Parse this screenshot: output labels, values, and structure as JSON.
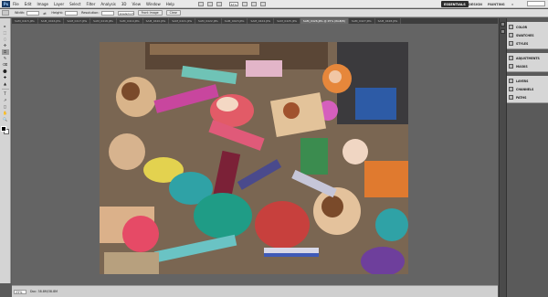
{
  "app": {
    "logo": "Ps"
  },
  "menu": [
    "File",
    "Edit",
    "Image",
    "Layer",
    "Select",
    "Filter",
    "Analysis",
    "3D",
    "View",
    "Window",
    "Help"
  ],
  "menubar": {
    "zoom": "67%",
    "workspaces": [
      "ESSENTIALS",
      "DESIGN",
      "PAINTING"
    ],
    "active_workspace": "ESSENTIALS",
    "more": "»"
  },
  "options": {
    "width_label": "Width:",
    "height_label": "Height:",
    "resolution_label": "Resolution:",
    "width_value": "",
    "height_value": "",
    "resolution_value": "",
    "unit": "pixels/inch",
    "front_image": "Front Image",
    "clear": "Clear"
  },
  "tabs": [
    {
      "label": "SAM_0415.JPG",
      "active": false
    },
    {
      "label": "SAM_0416.JPG",
      "active": false
    },
    {
      "label": "SAM_0417.JPG",
      "active": false
    },
    {
      "label": "SAM_0418.JPG",
      "active": false
    },
    {
      "label": "SAM_0419.JPG",
      "active": false
    },
    {
      "label": "SAM_0420.JPG",
      "active": false
    },
    {
      "label": "SAM_0421.JPG",
      "active": false
    },
    {
      "label": "SAM_0422.JPG",
      "active": false
    },
    {
      "label": "SAM_0423.JPG",
      "active": false
    },
    {
      "label": "SAM_0424.JPG",
      "active": false
    },
    {
      "label": "SAM_0425.JPG",
      "active": false
    },
    {
      "label": "SAM_0426.JPG @ 25% (RGB/8)",
      "active": true
    },
    {
      "label": "SAM_0427.JPG",
      "active": false
    },
    {
      "label": "SAM_0428.JPG",
      "active": false
    }
  ],
  "tools": [
    "▸",
    "⬚",
    "◌",
    "✣",
    "⌗",
    "✎",
    "⌫",
    "⬤",
    "✚",
    "▲",
    "T",
    "↗",
    "◻",
    "✋",
    "🔍"
  ],
  "status": {
    "zoom": "25%",
    "doc": "Doc: 38.8M/38.8M"
  },
  "panels": [
    {
      "group": [
        {
          "label": "COLOR",
          "icon": "color-icon"
        },
        {
          "label": "SWATCHES",
          "icon": "swatches-icon"
        },
        {
          "label": "STYLES",
          "icon": "styles-icon"
        }
      ]
    },
    {
      "group": [
        {
          "label": "ADJUSTMENTS",
          "icon": "adjustments-icon"
        },
        {
          "label": "MASKS",
          "icon": "masks-icon"
        }
      ]
    },
    {
      "group": [
        {
          "label": "LAYERS",
          "icon": "layers-icon"
        },
        {
          "label": "CHANNELS",
          "icon": "channels-icon"
        },
        {
          "label": "PATHS",
          "icon": "paths-icon"
        }
      ]
    }
  ]
}
